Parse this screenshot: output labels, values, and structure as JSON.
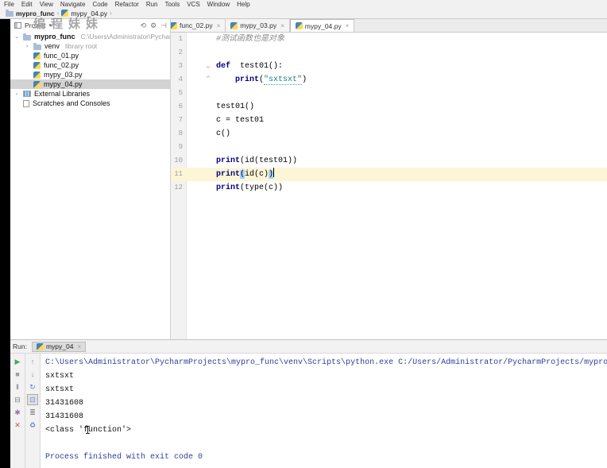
{
  "colors": {
    "keyword": "#000080",
    "string": "#1a8080",
    "comment": "#8c8c8c",
    "current_line": "#fcf5d6",
    "bracket_match": "#a3d1ff",
    "selected_row": "#d2d2d2",
    "run_green": "#4fa55b",
    "close_red": "#c75450",
    "console_system": "#2e3e9e"
  },
  "menu": {
    "items": [
      "File",
      "Edit",
      "View",
      "Navigate",
      "Code",
      "Refactor",
      "Run",
      "Tools",
      "VCS",
      "Window",
      "Help"
    ]
  },
  "breadcrumb": {
    "items": [
      {
        "label": "mypro_func",
        "icon": "folder"
      },
      {
        "label": "mypy_04.py",
        "icon": "py"
      }
    ],
    "separator": "›"
  },
  "watermark": {
    "text": "编程妹妹"
  },
  "project": {
    "header_label": "Project",
    "header_icons": [
      {
        "name": "refresh-icon",
        "glyph": "⟲"
      },
      {
        "name": "settings-gear-icon",
        "glyph": "⚙"
      },
      {
        "name": "hide-panel-icon",
        "glyph": "⊣"
      }
    ],
    "tree": [
      {
        "indent": 0,
        "chevron": "open",
        "icon": "folder",
        "label": "mypro_func",
        "bold": true,
        "extra": "C:\\Users\\Administrator\\PycharmProject",
        "selected": false,
        "name": "tree-item-mypro-func"
      },
      {
        "indent": 1,
        "chevron": "closed",
        "icon": "folder",
        "label": "venv",
        "bold": false,
        "extra": "library root",
        "selected": false,
        "name": "tree-item-venv"
      },
      {
        "indent": 1,
        "chevron": "none",
        "icon": "py",
        "label": "func_01.py",
        "bold": false,
        "extra": "",
        "selected": false,
        "name": "tree-item-func-01"
      },
      {
        "indent": 1,
        "chevron": "none",
        "icon": "py",
        "label": "func_02.py",
        "bold": false,
        "extra": "",
        "selected": false,
        "name": "tree-item-func-02"
      },
      {
        "indent": 1,
        "chevron": "none",
        "icon": "py",
        "label": "mypy_03.py",
        "bold": false,
        "extra": "",
        "selected": false,
        "name": "tree-item-mypy-03"
      },
      {
        "indent": 1,
        "chevron": "none",
        "icon": "py",
        "label": "mypy_04.py",
        "bold": false,
        "extra": "",
        "selected": true,
        "name": "tree-item-mypy-04"
      },
      {
        "indent": 0,
        "chevron": "closed",
        "icon": "lib",
        "label": "External Libraries",
        "bold": false,
        "extra": "",
        "selected": false,
        "name": "tree-item-external-libraries"
      },
      {
        "indent": 0,
        "chevron": "none",
        "icon": "scratch",
        "label": "Scratches and Consoles",
        "bold": false,
        "extra": "",
        "selected": false,
        "name": "tree-item-scratches"
      }
    ]
  },
  "editor": {
    "tabs": [
      {
        "label": "func_02.py",
        "active": false,
        "name": "tab-func-02"
      },
      {
        "label": "mypy_03.py",
        "active": false,
        "name": "tab-mypy-03"
      },
      {
        "label": "mypy_04.py",
        "active": true,
        "name": "tab-mypy-04"
      }
    ],
    "close_glyph": "×",
    "lines": [
      {
        "n": 1,
        "fold": "",
        "current": false,
        "parts": [
          [
            "comment",
            "#测试函数也是对象"
          ]
        ]
      },
      {
        "n": 2,
        "fold": "",
        "current": false,
        "parts": []
      },
      {
        "n": 3,
        "fold": "down",
        "current": false,
        "parts": [
          [
            "kw",
            "def"
          ],
          [
            "plain",
            "  test01():"
          ]
        ]
      },
      {
        "n": 4,
        "fold": "up",
        "current": false,
        "parts": [
          [
            "plain",
            "    "
          ],
          [
            "kw",
            "print"
          ],
          [
            "plain",
            "("
          ],
          [
            "str",
            "\"sxtsxt\""
          ],
          [
            "plain",
            ")"
          ]
        ]
      },
      {
        "n": 5,
        "fold": "",
        "current": false,
        "parts": []
      },
      {
        "n": 6,
        "fold": "",
        "current": false,
        "parts": [
          [
            "plain",
            "test01()"
          ]
        ]
      },
      {
        "n": 7,
        "fold": "",
        "current": false,
        "parts": [
          [
            "plain",
            "c = test01"
          ]
        ]
      },
      {
        "n": 8,
        "fold": "",
        "current": false,
        "parts": [
          [
            "plain",
            "c()"
          ]
        ]
      },
      {
        "n": 9,
        "fold": "",
        "current": false,
        "parts": []
      },
      {
        "n": 10,
        "fold": "",
        "current": false,
        "parts": [
          [
            "kw",
            "print"
          ],
          [
            "plain",
            "(id(test01))"
          ]
        ]
      },
      {
        "n": 11,
        "fold": "",
        "current": true,
        "parts": [
          [
            "kw",
            "print"
          ],
          [
            "bh",
            "("
          ],
          [
            "plain",
            "id(c)"
          ],
          [
            "bh",
            ")"
          ],
          [
            "caret",
            ""
          ]
        ]
      },
      {
        "n": 12,
        "fold": "",
        "current": false,
        "parts": [
          [
            "kw",
            "print"
          ],
          [
            "plain",
            "(type(c))"
          ]
        ]
      }
    ]
  },
  "run": {
    "label": "Run:",
    "tab": {
      "label": "mypy_04",
      "close": "×"
    },
    "toolbar_main": [
      {
        "name": "rerun-button",
        "glyph": "▶",
        "color": "#4fa55b"
      },
      {
        "name": "stop-button",
        "glyph": "■",
        "color": "#9f9f9f"
      },
      {
        "name": "pause-output-button",
        "glyph": "‖",
        "color": "#7a7a7a"
      },
      {
        "name": "restore-layout-button",
        "glyph": "⊟",
        "color": "#7a7a7a"
      },
      {
        "name": "pin-tab-button",
        "glyph": "✱",
        "color": "#9876aa"
      },
      {
        "name": "close-button",
        "glyph": "✕",
        "color": "#c75450"
      }
    ],
    "toolbar_console": [
      {
        "name": "up-stacktrace-button",
        "glyph": "↑",
        "color": "#8a8a8a"
      },
      {
        "name": "down-stacktrace-button",
        "glyph": "↓",
        "color": "#8a8a8a"
      },
      {
        "name": "softwrap-button",
        "glyph": "↻",
        "color": "#5c84c8"
      },
      {
        "name": "scroll-to-end-button",
        "glyph": "⊡",
        "color": "#5c84c8",
        "selected": true
      },
      {
        "name": "print-button",
        "glyph": "≣",
        "color": "#7a7a7a"
      },
      {
        "name": "clear-all-button",
        "glyph": "♻",
        "color": "#5c84c8"
      }
    ],
    "console": [
      {
        "type": "sys",
        "text": "C:\\Users\\Administrator\\PycharmProjects\\mypro_func\\venv\\Scripts\\python.exe C:/Users/Administrator/PycharmProjects/mypro_func/m"
      },
      {
        "type": "out",
        "text": "sxtsxt"
      },
      {
        "type": "out",
        "text": "sxtsxt"
      },
      {
        "type": "out",
        "text": "31431608"
      },
      {
        "type": "out",
        "text": "31431608"
      },
      {
        "type": "out",
        "text": "<class 'function'>"
      },
      {
        "type": "out",
        "text": ""
      },
      {
        "type": "sys",
        "text": "Process finished with exit code 0"
      }
    ]
  }
}
